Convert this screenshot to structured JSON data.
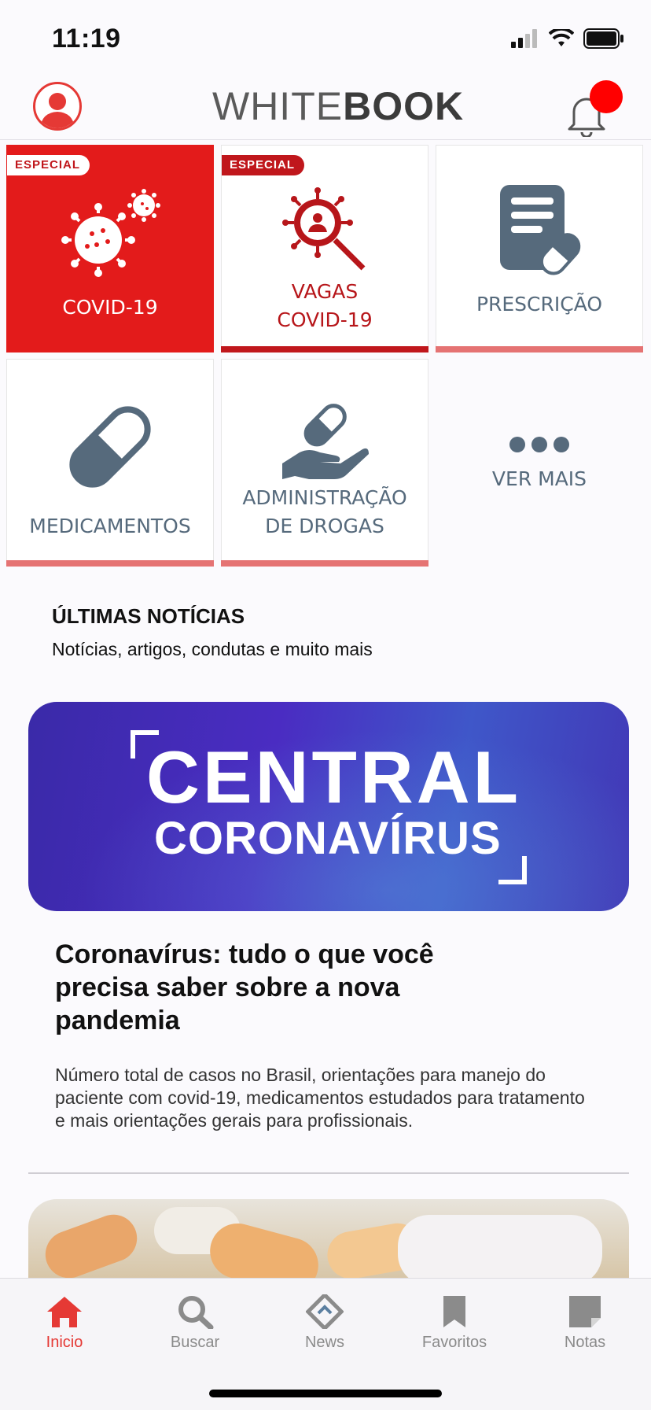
{
  "status": {
    "time": "11:19"
  },
  "header": {
    "logo_thin": "WHITE",
    "logo_bold": "BOOK"
  },
  "tiles": [
    {
      "label": "COVID-19",
      "badge": "ESPECIAL"
    },
    {
      "label_line1": "VAGAS",
      "label_line2": "COVID-19",
      "badge": "ESPECIAL"
    },
    {
      "label": "PRESCRIÇÃO"
    },
    {
      "label": "MEDICAMENTOS"
    },
    {
      "label_line1": "ADMINISTRAÇÃO",
      "label_line2": "DE DROGAS"
    },
    {
      "label": "VER MAIS"
    }
  ],
  "news": {
    "title": "ÚLTIMAS NOTÍCIAS",
    "subtitle": "Notícias, artigos, condutas e muito mais",
    "banner_line1": "CENTRAL",
    "banner_line2": "CORONAVÍRUS",
    "article_title": "Coronavírus: tudo o que você precisa saber sobre a nova pandemia",
    "article_body": "Número total de casos no Brasil, orientações para manejo do paciente com covid-19, medicamentos estudados para tratamento e mais orientações gerais para profissionais."
  },
  "tabbar": [
    {
      "label": "Inicio",
      "icon": "home-icon",
      "active": true
    },
    {
      "label": "Buscar",
      "icon": "search-icon"
    },
    {
      "label": "News",
      "icon": "news-icon"
    },
    {
      "label": "Favoritos",
      "icon": "bookmark-icon"
    },
    {
      "label": "Notas",
      "icon": "note-icon"
    }
  ],
  "colors": {
    "accent": "#e53935",
    "slate": "#566a7c",
    "badge_red": "#c0171c"
  }
}
